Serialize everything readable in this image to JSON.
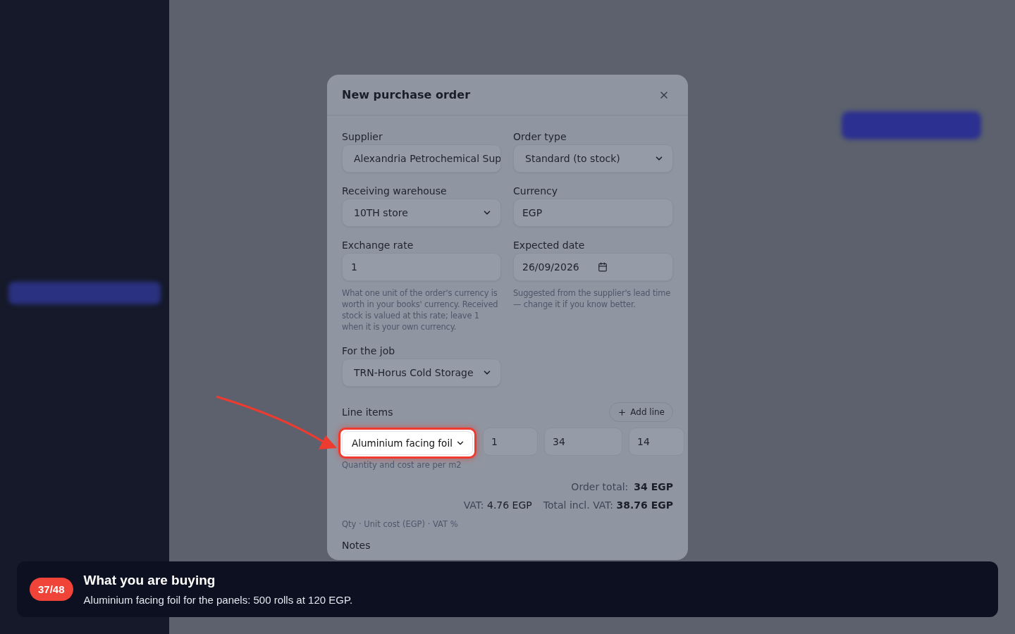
{
  "modal": {
    "title": "New purchase order",
    "fields": [
      {
        "label": "Supplier",
        "kind": "select",
        "value": "Alexandria Petrochemical Sup"
      },
      {
        "label": "Order type",
        "kind": "select",
        "value": "Standard (to stock)"
      },
      {
        "label": "Receiving warehouse",
        "kind": "select",
        "value": "10TH store"
      },
      {
        "label": "Currency",
        "kind": "text",
        "value": "EGP"
      },
      {
        "label": "Exchange rate",
        "kind": "text",
        "value": "1",
        "hint": "What one unit of the order's currency is worth in your books' currency. Received stock is valued at this rate; leave 1 when it is your own currency."
      },
      {
        "label": "Expected date",
        "kind": "date",
        "value": "26/09/2026",
        "hint": "Suggested from the supplier's lead time — change it if you know better."
      },
      {
        "label": "For the job",
        "kind": "select",
        "value": "TRN-Horus Cold Storage"
      }
    ],
    "line_items": {
      "title": "Line items",
      "add_button": "Add line",
      "rows": [
        {
          "item": "Aluminium facing foil",
          "highlighted": true,
          "qty": "1",
          "unit_cost": "34",
          "vat": "14",
          "hint": "Quantity and cost are per m2"
        }
      ],
      "order_total_label": "Order total:",
      "order_total": "34 EGP",
      "vat_label": "VAT:",
      "vat": "4.76 EGP",
      "total_incl_label": "Total incl. VAT:",
      "total_incl": "38.76 EGP",
      "columns_hint": "Qty · Unit cost (EGP) · VAT %"
    },
    "notes_label": "Notes"
  },
  "tour": {
    "step": "37/48",
    "title": "What you are buying",
    "text": "Aluminium facing foil for the panels: 500 rolls at 120 EGP."
  }
}
